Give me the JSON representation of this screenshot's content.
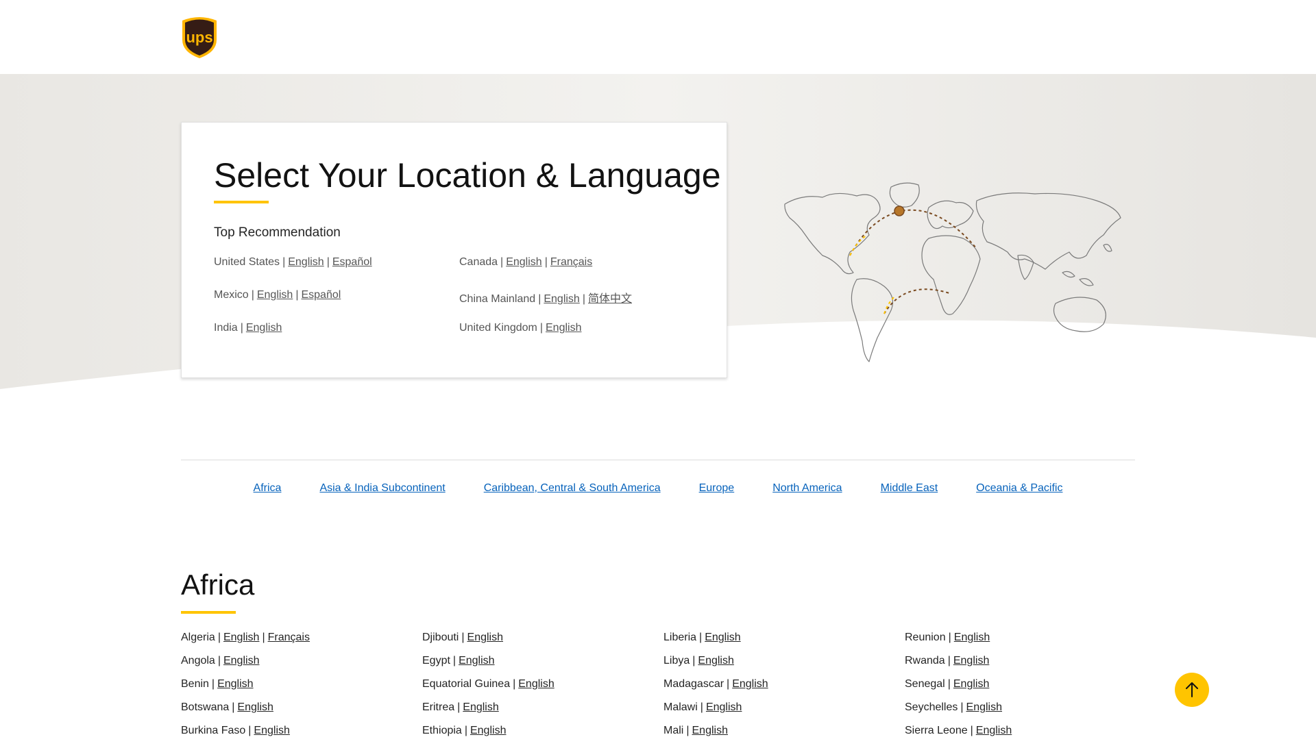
{
  "header": {
    "logo_text": "ups"
  },
  "card": {
    "title": "Select Your Location & Language",
    "subtitle": "Top Recommendation",
    "recommendations": [
      {
        "country": "United States",
        "languages": [
          "English",
          "Español"
        ]
      },
      {
        "country": "Canada",
        "languages": [
          "English",
          "Français"
        ]
      },
      {
        "country": "Mexico",
        "languages": [
          "English",
          "Español"
        ]
      },
      {
        "country": "China Mainland",
        "languages": [
          "English",
          "简体中文"
        ]
      },
      {
        "country": "India",
        "languages": [
          "English"
        ]
      },
      {
        "country": "United Kingdom",
        "languages": [
          "English"
        ]
      }
    ]
  },
  "regions": [
    "Africa",
    "Asia & India Subcontinent",
    "Caribbean, Central & South America",
    "Europe",
    "North America",
    "Middle East",
    "Oceania & Pacific"
  ],
  "section": {
    "title": "Africa",
    "columns": [
      [
        {
          "country": "Algeria",
          "languages": [
            "English",
            "Français"
          ]
        },
        {
          "country": "Angola",
          "languages": [
            "English"
          ]
        },
        {
          "country": "Benin",
          "languages": [
            "English"
          ]
        },
        {
          "country": "Botswana",
          "languages": [
            "English"
          ]
        },
        {
          "country": "Burkina Faso",
          "languages": [
            "English"
          ]
        }
      ],
      [
        {
          "country": "Djibouti",
          "languages": [
            "English"
          ]
        },
        {
          "country": "Egypt",
          "languages": [
            "English"
          ]
        },
        {
          "country": "Equatorial Guinea",
          "languages": [
            "English"
          ]
        },
        {
          "country": "Eritrea",
          "languages": [
            "English"
          ]
        },
        {
          "country": "Ethiopia",
          "languages": [
            "English"
          ]
        }
      ],
      [
        {
          "country": "Liberia",
          "languages": [
            "English"
          ]
        },
        {
          "country": "Libya",
          "languages": [
            "English"
          ]
        },
        {
          "country": "Madagascar",
          "languages": [
            "English"
          ]
        },
        {
          "country": "Malawi",
          "languages": [
            "English"
          ]
        },
        {
          "country": "Mali",
          "languages": [
            "English"
          ]
        }
      ],
      [
        {
          "country": "Reunion",
          "languages": [
            "English"
          ]
        },
        {
          "country": "Rwanda",
          "languages": [
            "English"
          ]
        },
        {
          "country": "Senegal",
          "languages": [
            "English"
          ]
        },
        {
          "country": "Seychelles",
          "languages": [
            "English"
          ]
        },
        {
          "country": "Sierra Leone",
          "languages": [
            "English"
          ]
        }
      ]
    ]
  },
  "icons": {
    "logo": "ups-shield-logo",
    "map": "world-map-illustration",
    "back_to_top": "arrow-up-icon"
  },
  "colors": {
    "brand_gold": "#ffc400",
    "brand_brown": "#351c15",
    "link_blue": "#0662bb"
  }
}
